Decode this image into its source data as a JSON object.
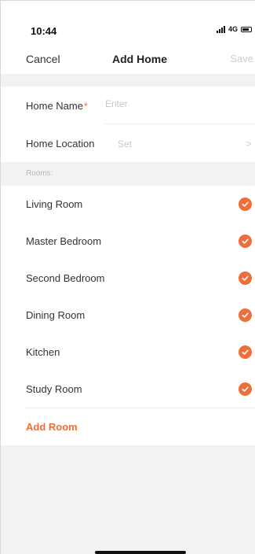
{
  "status": {
    "time": "10:44",
    "network": "4G"
  },
  "nav": {
    "cancel": "Cancel",
    "title": "Add Home",
    "save": "Save"
  },
  "form": {
    "home_name_label": "Home Name",
    "required_mark": "*",
    "home_name_placeholder": "Enter",
    "home_location_label": "Home Location",
    "home_location_value": "Set",
    "chevron": ">"
  },
  "rooms": {
    "header": "Rooms:",
    "items": [
      {
        "label": "Living Room",
        "checked": true
      },
      {
        "label": "Master Bedroom",
        "checked": true
      },
      {
        "label": "Second Bedroom",
        "checked": true
      },
      {
        "label": "Dining Room",
        "checked": true
      },
      {
        "label": "Kitchen",
        "checked": true
      },
      {
        "label": "Study Room",
        "checked": true
      }
    ],
    "add_label": "Add Room"
  },
  "colors": {
    "accent": "#ef6e3a",
    "background": "#f2f2f4"
  },
  "icons": [
    "signal-icon",
    "battery-icon",
    "chevron-right-icon",
    "check-icon"
  ]
}
